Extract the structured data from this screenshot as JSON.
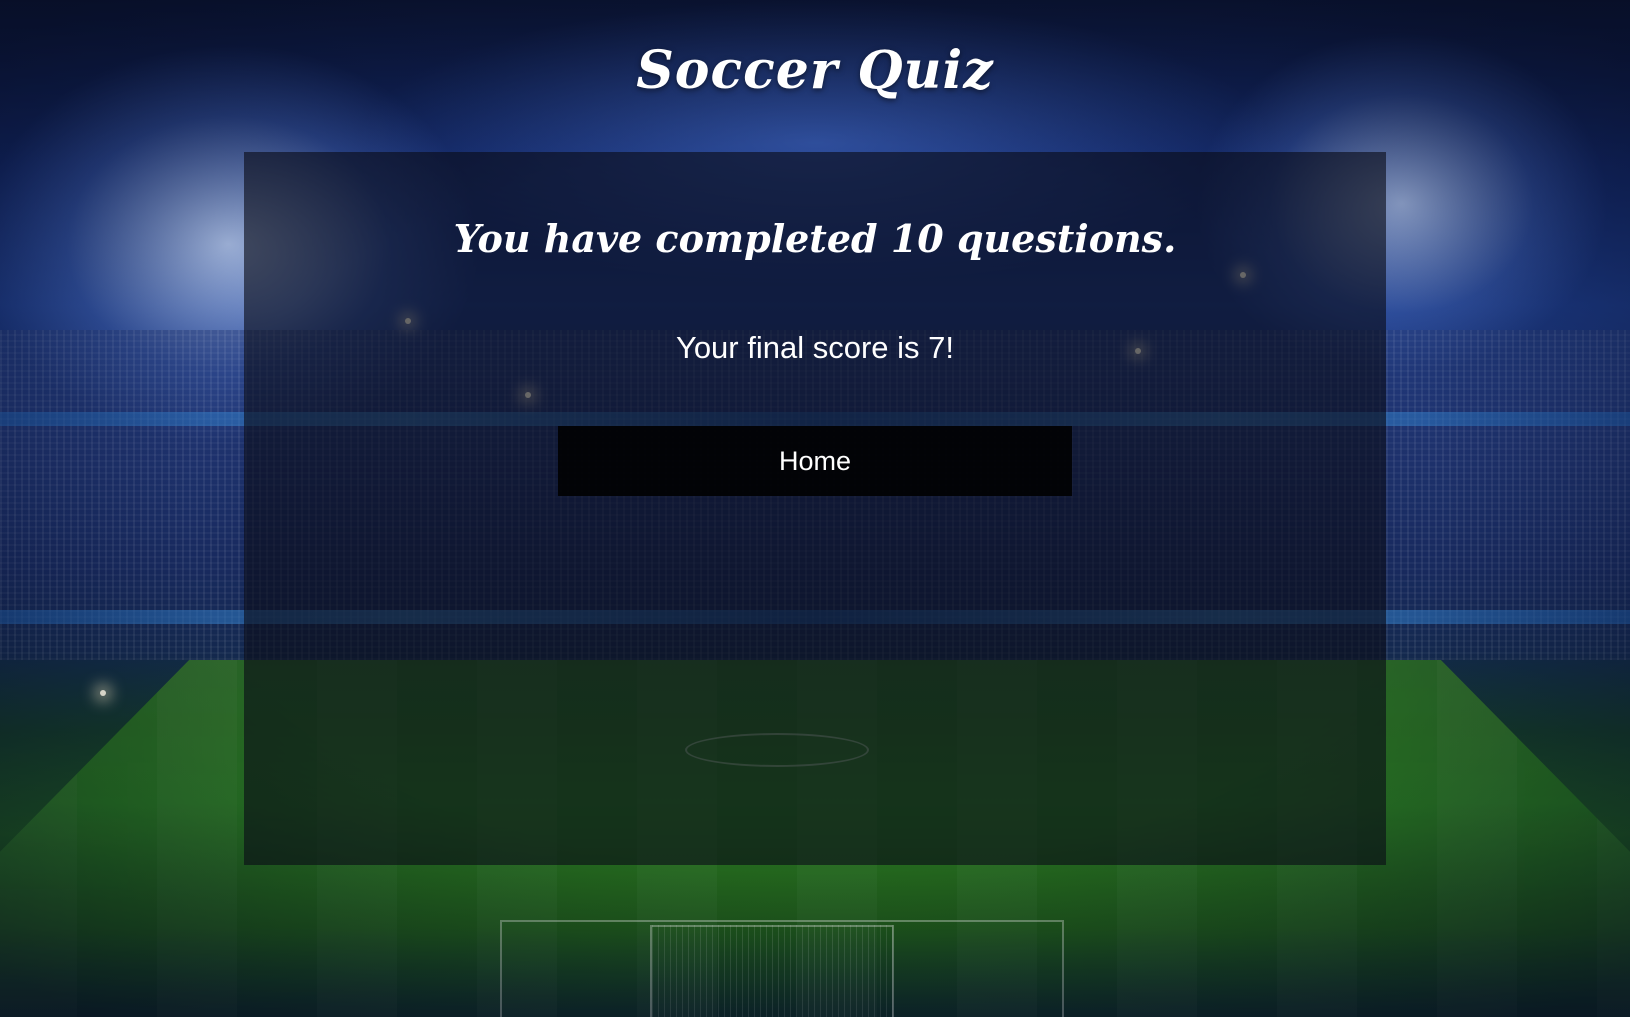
{
  "header": {
    "title": "Soccer Quiz"
  },
  "result": {
    "heading": "You have completed 10 questions.",
    "score_text": "Your final score is 7!",
    "home_button_label": "Home"
  },
  "theme": {
    "panel_color": "#0a0c16",
    "text_color": "#ffffff",
    "button_color": "#000000"
  }
}
